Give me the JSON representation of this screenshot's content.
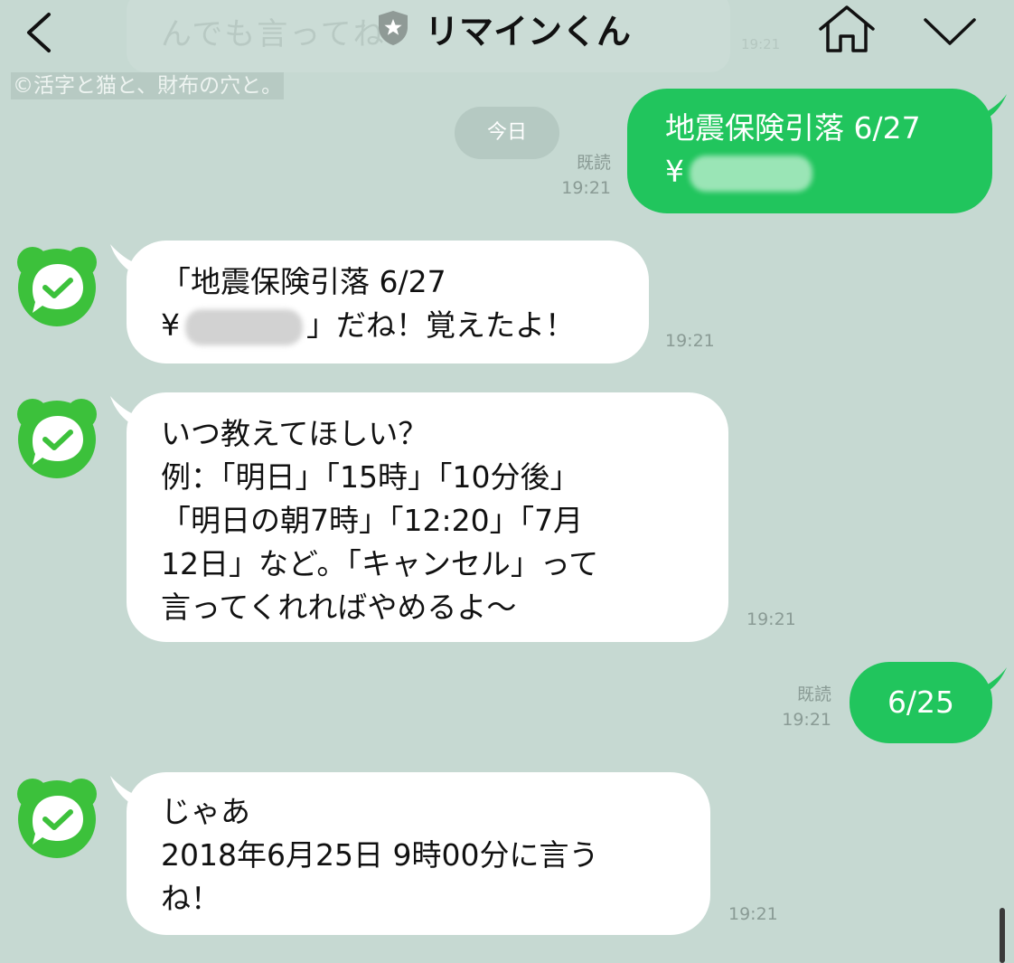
{
  "header": {
    "faded_text": "んでも言ってね",
    "faded_time": "19:21",
    "title": "リマインくん"
  },
  "watermark": "©活字と猫と、財布の穴と。",
  "date_divider": "今日",
  "messages": [
    {
      "side": "out",
      "read": "既読",
      "time": "19:21",
      "lines": [
        "地震保険引落 6/27",
        "¥"
      ]
    },
    {
      "side": "in",
      "time": "19:21",
      "lines": [
        "「地震保険引落 6/27",
        "¥",
        "」だね！覚えたよ！"
      ]
    },
    {
      "side": "in",
      "time": "19:21",
      "lines": [
        "いつ教えてほしい？",
        "例：「明日」「15時」「10分後」",
        "「明日の朝7時」「12:20」「7月",
        "12日」など。「キャンセル」って",
        "言ってくれればやめるよ〜"
      ]
    },
    {
      "side": "out",
      "read": "既読",
      "time": "19:21",
      "lines": [
        "6/25"
      ]
    },
    {
      "side": "in",
      "time": "19:21",
      "lines": [
        "じゃあ",
        "2018年6月25日  9時00分に言う",
        "ね！"
      ]
    }
  ],
  "icons": {
    "back": "chevron-left-icon",
    "shield": "shield-star-icon",
    "home": "home-icon",
    "menu": "chevron-down-icon",
    "avatar": "bot-check-icon"
  },
  "colors": {
    "background": "#c6d9d2",
    "outgoing_bubble": "#21c55d",
    "incoming_bubble": "#ffffff",
    "avatar_green": "#3cc13b"
  }
}
